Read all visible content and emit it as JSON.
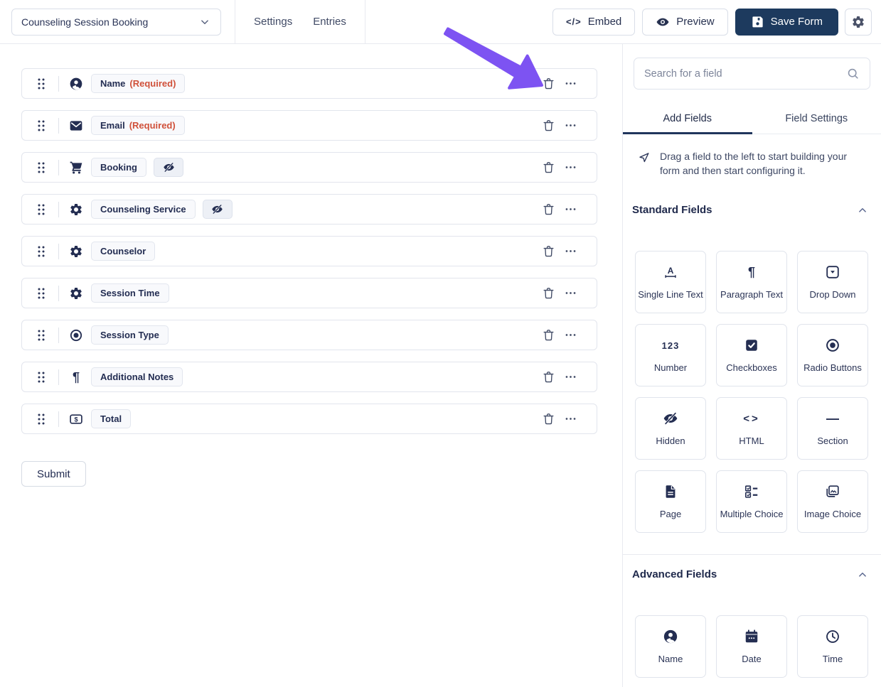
{
  "colors": {
    "accent_navy": "#1d3a5e",
    "arrow_purple": "#7d53f2",
    "required_red": "#d0513a"
  },
  "topbar": {
    "form_selector_value": "Counseling Session Booking",
    "nav": [
      {
        "label": "Settings"
      },
      {
        "label": "Entries"
      }
    ],
    "embed_label": "Embed",
    "preview_label": "Preview",
    "save_label": "Save Form"
  },
  "canvas": {
    "rows": [
      {
        "icon": "user-circle",
        "label": "Name",
        "required": "(Required)",
        "hidden": false
      },
      {
        "icon": "envelope",
        "label": "Email",
        "required": "(Required)",
        "hidden": false
      },
      {
        "icon": "cart",
        "label": "Booking",
        "hidden": true
      },
      {
        "icon": "gear",
        "label": "Counseling Service",
        "hidden": true
      },
      {
        "icon": "gear",
        "label": "Counselor",
        "hidden": false
      },
      {
        "icon": "gear",
        "label": "Session Time",
        "hidden": false
      },
      {
        "icon": "radio",
        "label": "Session Type",
        "hidden": false
      },
      {
        "icon": "pilcrow",
        "label": "Additional Notes",
        "hidden": false
      },
      {
        "icon": "dollar",
        "label": "Total",
        "hidden": false
      }
    ],
    "submit_label": "Submit"
  },
  "sidebar": {
    "search_placeholder": "Search for a field",
    "tabs": [
      {
        "label": "Add Fields",
        "active": true
      },
      {
        "label": "Field Settings",
        "active": false
      }
    ],
    "hint": "Drag a field to the left to start building your form and then start configuring it.",
    "sections": [
      {
        "title": "Standard Fields",
        "items": [
          {
            "icon": "single-line-text",
            "label": "Single Line Text"
          },
          {
            "icon": "pilcrow",
            "label": "Paragraph Text"
          },
          {
            "icon": "dropdown",
            "label": "Drop Down"
          },
          {
            "icon": "number",
            "label": "Number"
          },
          {
            "icon": "checkbox",
            "label": "Checkboxes"
          },
          {
            "icon": "radio",
            "label": "Radio Buttons"
          },
          {
            "icon": "eye-off",
            "label": "Hidden"
          },
          {
            "icon": "html-code",
            "label": "HTML"
          },
          {
            "icon": "section-line",
            "label": "Section"
          },
          {
            "icon": "page",
            "label": "Page"
          },
          {
            "icon": "multiple-choice",
            "label": "Multiple Choice"
          },
          {
            "icon": "image-choice",
            "label": "Image Choice"
          }
        ]
      },
      {
        "title": "Advanced Fields",
        "items": [
          {
            "icon": "user-circle",
            "label": "Name"
          },
          {
            "icon": "calendar",
            "label": "Date"
          },
          {
            "icon": "clock",
            "label": "Time"
          }
        ]
      }
    ]
  }
}
